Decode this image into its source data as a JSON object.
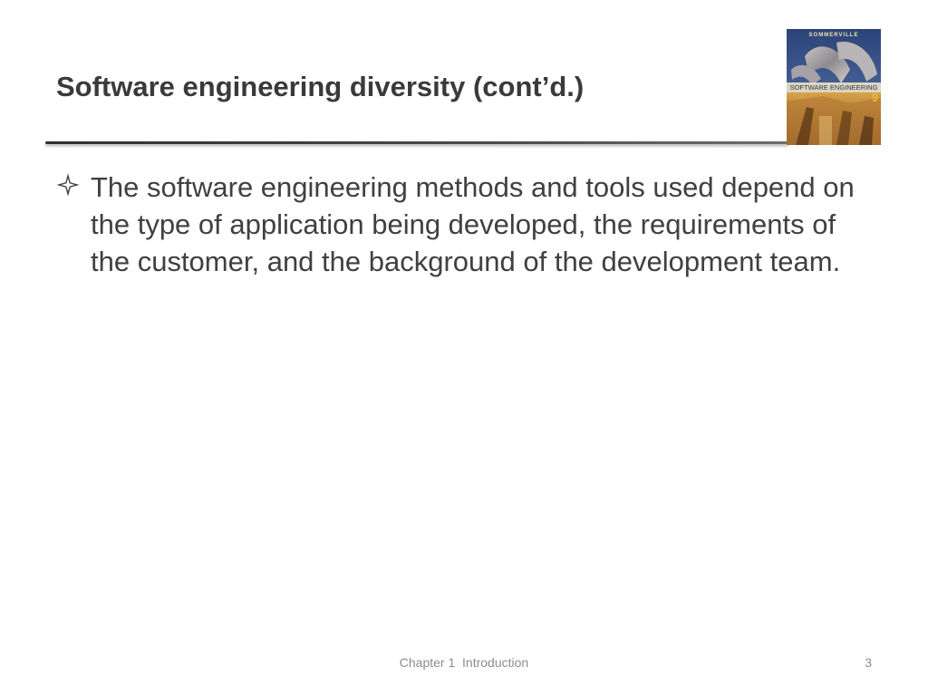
{
  "slide": {
    "title": "Software engineering diversity (cont’d.)",
    "bullets": [
      {
        "marker_icon": "four-point-star-outline-icon",
        "text": "The software engineering methods and tools used depend on the type of application being developed, the requirements of the customer, and the background of the development team."
      }
    ]
  },
  "book_cover": {
    "author": "SOMMERVILLE",
    "title": "SOFTWARE ENGINEERING",
    "edition": "9"
  },
  "footer": {
    "chapter": "Chapter 1  Introduction",
    "page_number": "3"
  },
  "colors": {
    "title_text": "#3a3a3a",
    "body_text": "#404040",
    "footer_text": "#8c8c8c",
    "rule": "#3a3a3a",
    "cover_sky": "#34508c",
    "cover_band": "#e9e0c4",
    "cover_edition": "#f2b33a"
  }
}
